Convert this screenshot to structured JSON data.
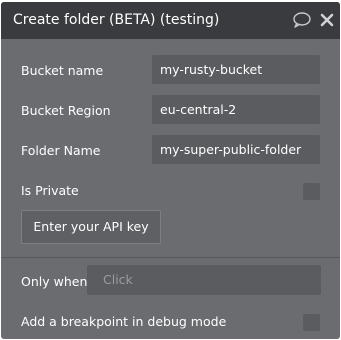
{
  "title": "Create folder (BETA) (testing)",
  "icons": {
    "comment": "comment-icon",
    "close": "close-icon"
  },
  "fields": [
    {
      "label": "Bucket name",
      "value": "my-rusty-bucket"
    },
    {
      "label": "Bucket Region",
      "value": "eu-central-2"
    },
    {
      "label": "Folder Name",
      "value": "my-super-public-folder"
    }
  ],
  "is_private": {
    "label": "Is Private",
    "checked": false
  },
  "api_button_label": "Enter your API key",
  "only_when": {
    "label": "Only when",
    "placeholder": "Click"
  },
  "breakpoint": {
    "label": "Add a breakpoint in debug mode",
    "checked": false
  },
  "colors": {
    "panel_bg": "#6a6c70",
    "titlebar_bg": "#3a3b3e",
    "field_bg": "#5a5c60",
    "text": "#ffffff"
  }
}
